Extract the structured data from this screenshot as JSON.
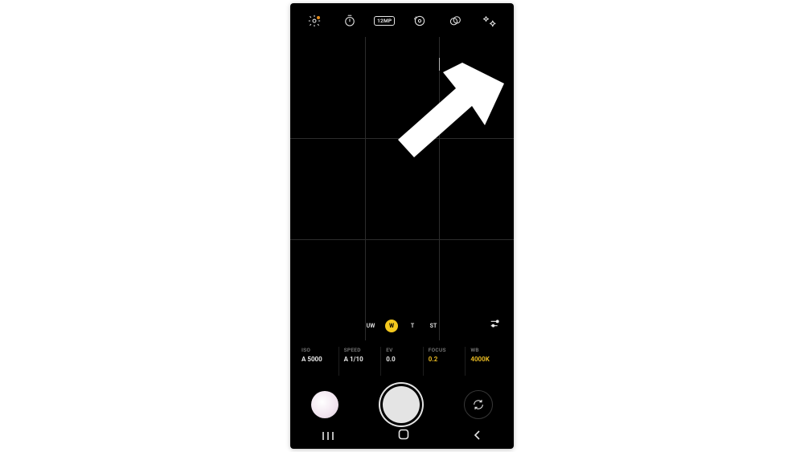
{
  "topbar": {
    "settings_icon": "settings",
    "timer_icon": "timer",
    "resolution_label": "12MP",
    "refresh_icon": "motion",
    "overlap_icon": "filters",
    "sparkle_icon": "effects"
  },
  "lenses": {
    "uw": "UW",
    "w": "W",
    "t": "T",
    "st": "ST",
    "selected": "w"
  },
  "params": {
    "iso": {
      "label": "ISO",
      "value": "A 5000",
      "hl": false
    },
    "speed": {
      "label": "SPEED",
      "value": "A 1/10",
      "hl": false
    },
    "ev": {
      "label": "EV",
      "value": "0.0",
      "hl": false
    },
    "focus": {
      "label": "FOCUS",
      "value": "0.2",
      "hl": true
    },
    "wb": {
      "label": "WB",
      "value": "4000K",
      "hl": true
    }
  }
}
